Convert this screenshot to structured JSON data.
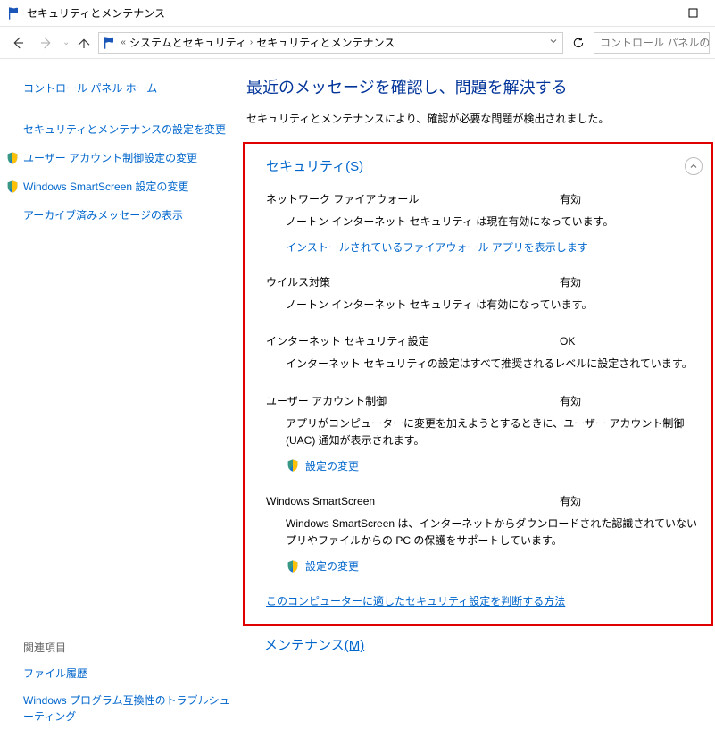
{
  "window": {
    "title": "セキュリティとメンテナンス"
  },
  "nav": {
    "crumb_a": "システムとセキュリティ",
    "crumb_b": "セキュリティとメンテナンス",
    "search_placeholder": "コントロール パネルの"
  },
  "sidebar": {
    "home": "コントロール パネル ホーム",
    "link_settings": "セキュリティとメンテナンスの設定を変更",
    "link_uac": "ユーザー アカウント制御設定の変更",
    "link_smartscreen": "Windows SmartScreen 設定の変更",
    "link_archived": "アーカイブ済みメッセージの表示",
    "related_title": "関連項目",
    "related_a": "ファイル履歴",
    "related_b": "Windows プログラム互換性のトラブルシューティング"
  },
  "main": {
    "heading": "最近のメッセージを確認し、問題を解決する",
    "subheading": "セキュリティとメンテナンスにより、確認が必要な問題が検出されました。"
  },
  "security": {
    "title_base": "セキュリティ",
    "title_accel": "(S)",
    "items": [
      {
        "label": "ネットワーク ファイアウォール",
        "status": "有効",
        "desc": "ノートン インターネット セキュリティ は現在有効になっています。",
        "link": "インストールされているファイアウォール アプリを表示します",
        "link_has_shield": false
      },
      {
        "label": "ウイルス対策",
        "status": "有効",
        "desc": "ノートン インターネット セキュリティ は有効になっています。",
        "link": "",
        "link_has_shield": false
      },
      {
        "label": "インターネット セキュリティ設定",
        "status": "OK",
        "desc": "インターネット セキュリティの設定はすべて推奨されるレベルに設定されています。",
        "link": "",
        "link_has_shield": false
      },
      {
        "label": "ユーザー アカウント制御",
        "status": "有効",
        "desc": "アプリがコンピューターに変更を加えようとするときに、ユーザー アカウント制御 (UAC) 通知が表示されます。",
        "link": "設定の変更",
        "link_has_shield": true
      },
      {
        "label": "Windows SmartScreen",
        "status": "有効",
        "desc": "Windows SmartScreen は、インターネットからダウンロードされた認識されていないプリやファイルからの PC の保護をサポートしています。",
        "link": "設定の変更",
        "link_has_shield": true
      }
    ],
    "bottom_link": "このコンピューターに適したセキュリティ設定を判断する方法"
  },
  "maintenance": {
    "title_base": "メンテナンス",
    "title_accel": "(M)"
  }
}
